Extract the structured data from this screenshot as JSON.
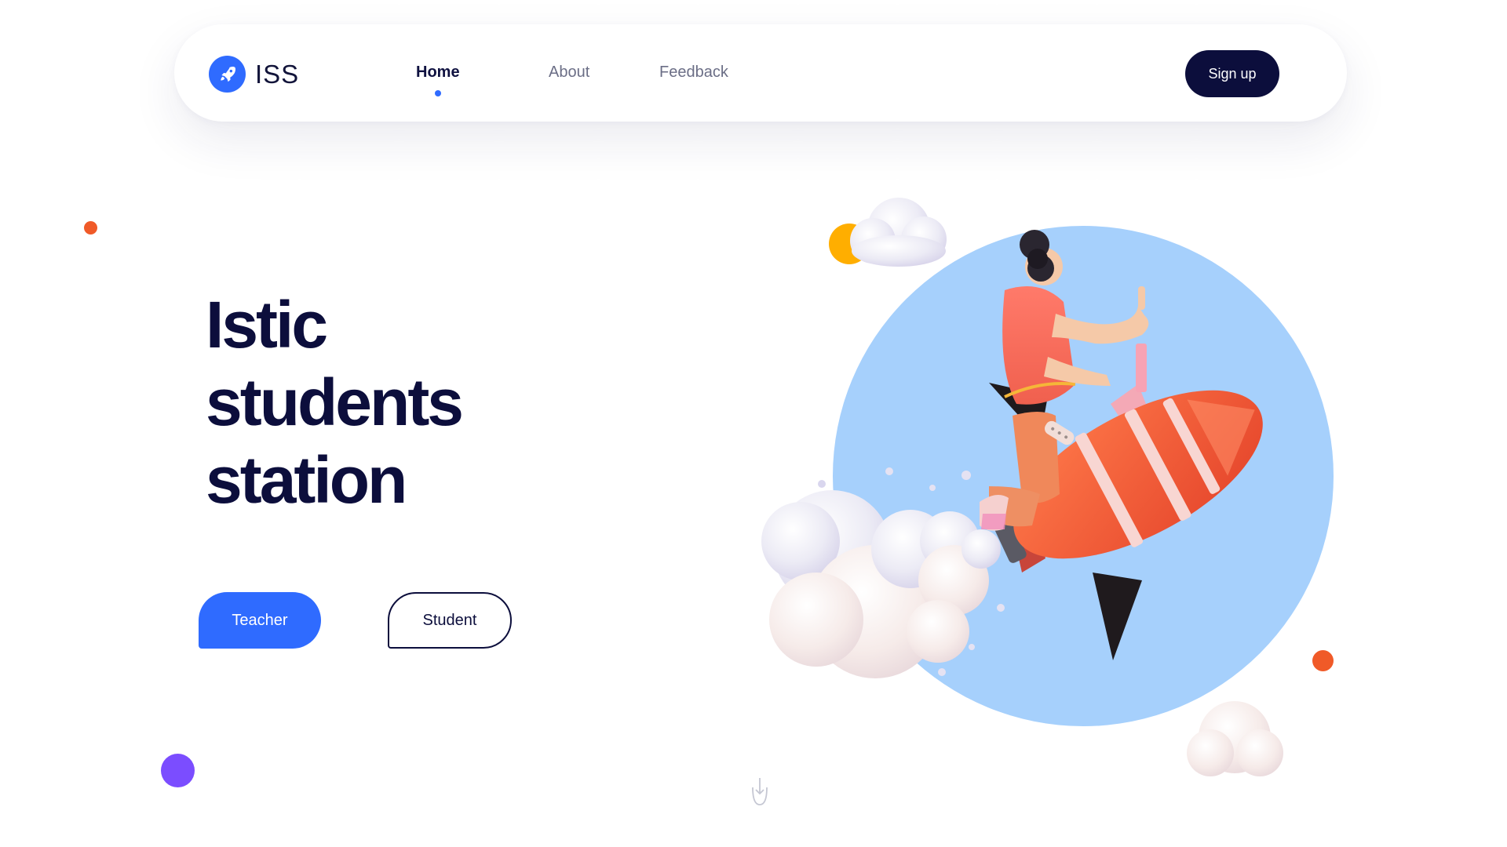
{
  "brand": {
    "name": "ISS",
    "icon": "rocket-icon",
    "accent": "#2f6bff"
  },
  "nav": {
    "items": [
      {
        "label": "Home",
        "active": true
      },
      {
        "label": "About",
        "active": false
      },
      {
        "label": "Feedback",
        "active": false
      }
    ],
    "signup_label": "Sign up"
  },
  "hero": {
    "title_lines": [
      "Istic",
      "students",
      "station"
    ],
    "teacher_label": "Teacher",
    "student_label": "Student"
  },
  "icons": {
    "scroll": "mouse-scroll-down-icon"
  },
  "colors": {
    "primary": "#2f6bff",
    "dark": "#0c0e3c",
    "circle": "#a6d0fc",
    "orange": "#f05a28",
    "purple": "#7b4dff",
    "yellow": "#ffae00"
  }
}
